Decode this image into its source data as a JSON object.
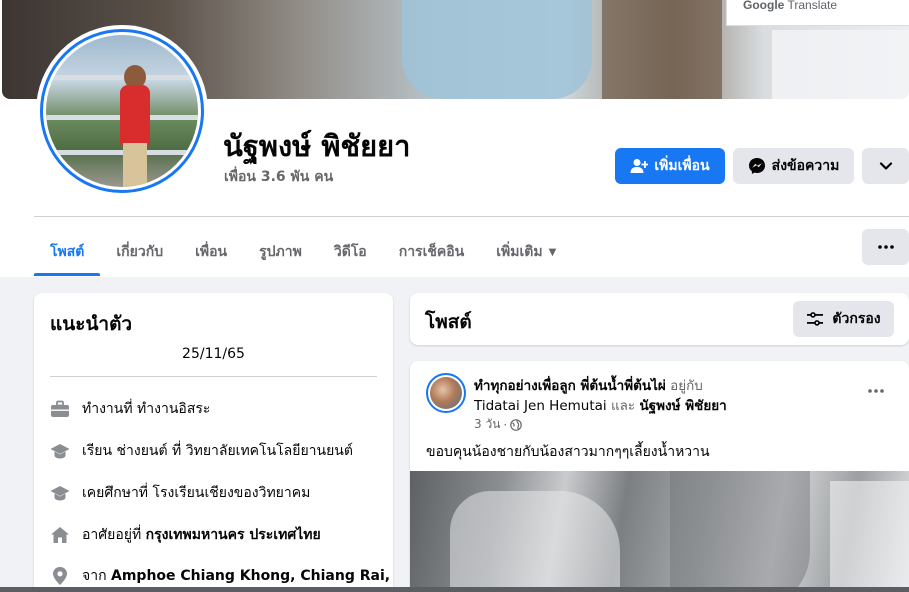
{
  "translate_popup": {
    "brand": "Google",
    "label": "Translate"
  },
  "profile": {
    "name": "นัฐพงษ์ พิชัยยา",
    "friends": "เพื่อน 3.6 พัน คน"
  },
  "actions": {
    "add_friend": "เพิ่มเพื่อน",
    "message": "ส่งข้อความ"
  },
  "tabs": [
    {
      "label": "โพสต์",
      "active": true
    },
    {
      "label": "เกี่ยวกับ"
    },
    {
      "label": "เพื่อน"
    },
    {
      "label": "รูปภาพ"
    },
    {
      "label": "วิดีโอ"
    },
    {
      "label": "การเช็คอิน"
    },
    {
      "label": "เพิ่มเติม"
    }
  ],
  "intro": {
    "title": "แนะนำตัว",
    "bio": "25/11/65",
    "items": [
      {
        "icon": "briefcase-icon",
        "prefix": "ทำงานที่ ",
        "value": "ทำงานอิสระ"
      },
      {
        "icon": "graduation-cap-icon",
        "prefix": "เรียน ช่างยนต์ ที่ ",
        "value": "วิทยาลัยเทคโนโลยียานยนต์"
      },
      {
        "icon": "graduation-cap-icon",
        "prefix": "เคยศึกษาที่ ",
        "value": "โรงเรียนเชียงของวิทยาคม"
      },
      {
        "icon": "home-icon",
        "prefix": "อาศัยอยู่ที่ ",
        "value": "กรุงเทพมหานคร ประเทศไทย"
      },
      {
        "icon": "location-pin-icon",
        "prefix": "จาก ",
        "value": "Amphoe Chiang Khong, Chiang Rai,"
      }
    ]
  },
  "posts_header": {
    "title": "โพสต์",
    "filter": "ตัวกรอง"
  },
  "post": {
    "author": "ทำทุกอย่างเพื่อลูก พี่ต้นน้ำพี่ต้นไผ่",
    "with_text": "อยู่กับ",
    "tagged1": "Tidatai Jen Hemutai",
    "and_text": "และ",
    "tagged2": "นัฐพงษ์ พิชัยยา",
    "time": "3 วัน",
    "separator": "·",
    "text": "ขอบคุนน้องชายกับน้องสาวมากๆๆเลี้ยงน้ำหวาน"
  },
  "colors": {
    "accent": "#1877f2",
    "secondary_button": "#e4e6eb",
    "page_background": "#f0f2f5",
    "muted_text": "#65676b"
  }
}
